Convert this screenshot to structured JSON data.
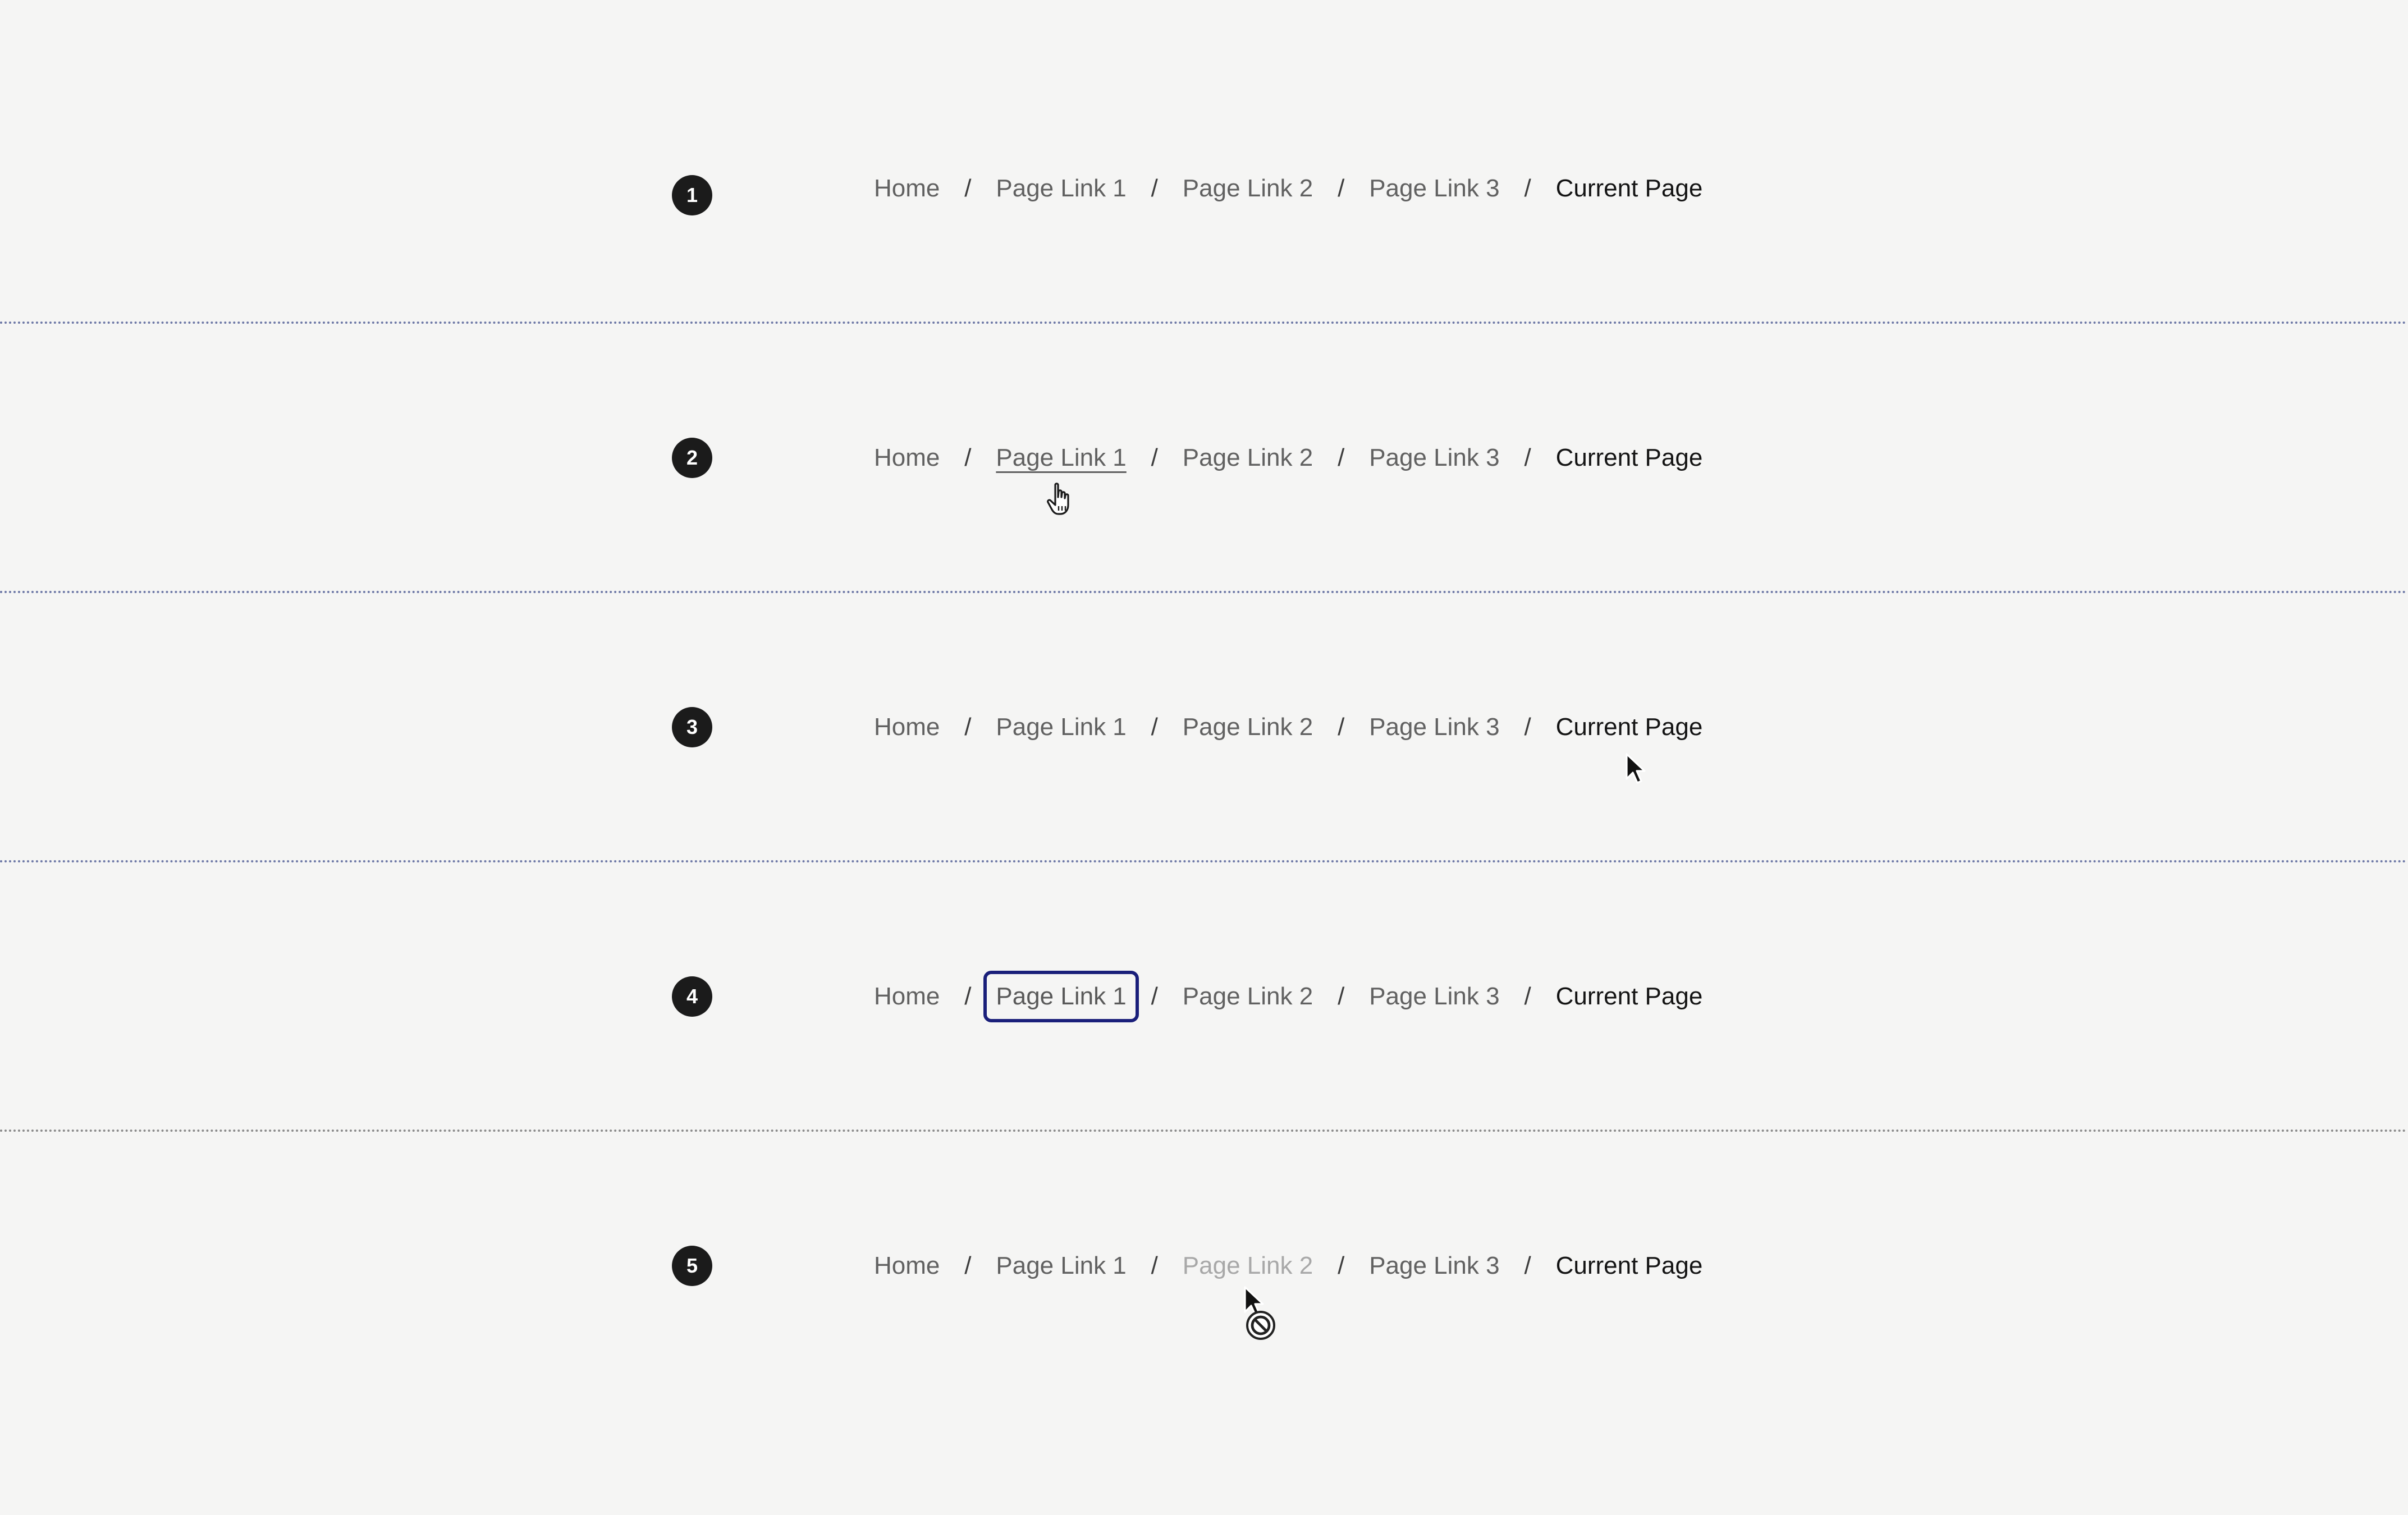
{
  "rows": [
    {
      "step": "1",
      "breadcrumb": [
        "Home",
        "Page Link 1",
        "Page Link 2",
        "Page Link 3",
        "Current Page"
      ],
      "separator": "/"
    },
    {
      "step": "2",
      "breadcrumb": [
        "Home",
        "Page Link 1",
        "Page Link 2",
        "Page Link 3",
        "Current Page"
      ],
      "separator": "/"
    },
    {
      "step": "3",
      "breadcrumb": [
        "Home",
        "Page Link 1",
        "Page Link 2",
        "Page Link 3",
        "Current Page"
      ],
      "separator": "/"
    },
    {
      "step": "4",
      "breadcrumb": [
        "Home",
        "Page Link 1",
        "Page Link 2",
        "Page Link 3",
        "Current Page"
      ],
      "separator": "/"
    },
    {
      "step": "5",
      "breadcrumb": [
        "Home",
        "Page Link 1",
        "Page Link 2",
        "Page Link 3",
        "Current Page"
      ],
      "separator": "/"
    }
  ],
  "colors": {
    "background": "#f5f5f4",
    "link": "#616161",
    "current": "#141414",
    "disabled": "#a8a8a8",
    "focus_ring": "#1a1f7a",
    "badge": "#1b1b1b",
    "divider": "#6d78a6"
  },
  "icons": {
    "hover_cursor": "hand-pointer-icon",
    "default_cursor": "arrow-cursor-icon",
    "disabled_cursor": "not-allowed-cursor-icon"
  }
}
